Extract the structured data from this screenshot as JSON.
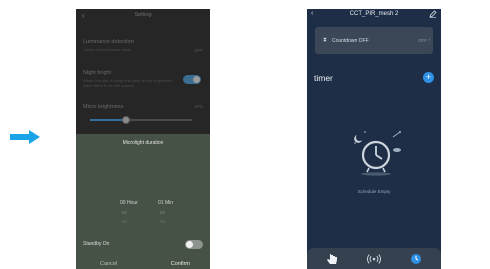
{
  "left_screen": {
    "header": {
      "title": "Setting"
    },
    "luminance": {
      "title": "Luminance detection",
      "subtitle": "Check the luminance value",
      "value": "OFF"
    },
    "night_bright": {
      "title": "Night bright",
      "subtitle": "When it is dim, it keeps the lamp at low brightness when there is no one around"
    },
    "micro_brightness": {
      "title": "Micro brightness",
      "value": "10%",
      "level": 0.35
    },
    "sheet": {
      "title": "Microlight duration",
      "selected_hour": "00 Hour",
      "selected_min": "01 Min",
      "next_hour": "01",
      "next_min": "02",
      "next2_hour": "02",
      "next2_min": "03",
      "standby_label": "Standby On",
      "standby_on": false,
      "cancel": "Cancel",
      "confirm": "Confirm"
    }
  },
  "right_screen": {
    "header": {
      "title": "CCT_PIR_mesh 2"
    },
    "countdown": {
      "label": "Countdown OFF",
      "value": "OFF"
    },
    "section_title": "timer",
    "add_icon": "+",
    "empty_text": "Schedule Empty",
    "tabs": [
      "hand-pointer-icon",
      "broadcast-icon",
      "clock-icon"
    ]
  },
  "colors": {
    "arrow": "#1aa3e6",
    "accent_blue": "#2e91e6",
    "right_bg": "#1d2e46",
    "sheet_bg": "#465246"
  }
}
